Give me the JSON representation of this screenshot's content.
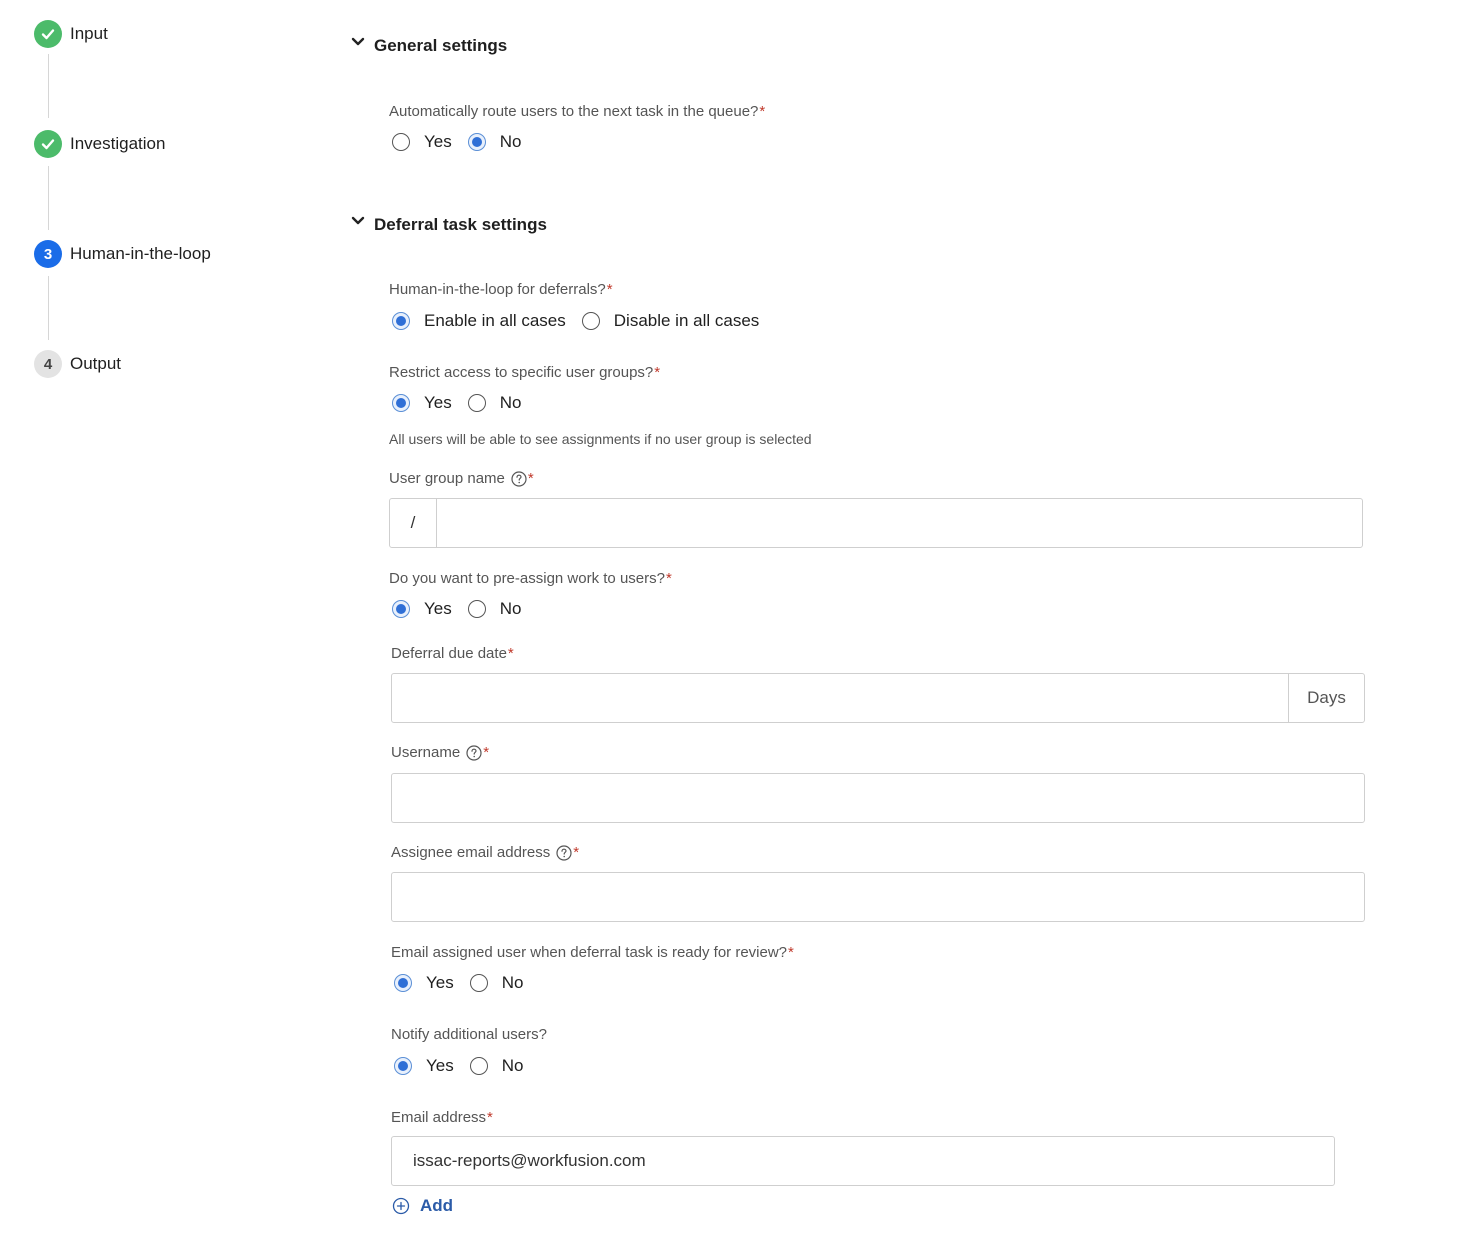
{
  "stepper": {
    "steps": [
      {
        "number": "",
        "label": "Input",
        "state": "done"
      },
      {
        "number": "",
        "label": "Investigation",
        "state": "done"
      },
      {
        "number": "3",
        "label": "Human-in-the-loop",
        "state": "active"
      },
      {
        "number": "4",
        "label": "Output",
        "state": "pending"
      }
    ]
  },
  "general": {
    "title": "General settings",
    "route_question": "Automatically route users to the next task in the queue?",
    "route_options": [
      "Yes",
      "No"
    ],
    "route_selected": "No"
  },
  "deferral": {
    "title": "Deferral task settings",
    "hitl_question": "Human-in-the-loop for deferrals?",
    "hitl_options": [
      "Enable in all cases",
      "Disable in all cases"
    ],
    "hitl_selected": "Enable in all cases",
    "restrict_question": "Restrict access to specific user groups?",
    "restrict_options": [
      "Yes",
      "No"
    ],
    "restrict_selected": "Yes",
    "restrict_hint": "All users will be able to see assignments if no user group is selected",
    "user_group_label": "User group name",
    "user_group_prefix": "/",
    "user_group_value": "",
    "preassign_question": "Do you want to pre-assign work to users?",
    "preassign_options": [
      "Yes",
      "No"
    ],
    "preassign_selected": "Yes",
    "due_date_label": "Deferral due date",
    "due_date_value": "",
    "due_date_suffix": "Days",
    "username_label": "Username",
    "username_value": "",
    "assignee_email_label": "Assignee email address",
    "assignee_email_value": "",
    "email_review_question": "Email assigned user when deferral task is ready for review?",
    "email_review_options": [
      "Yes",
      "No"
    ],
    "email_review_selected": "Yes",
    "notify_question": "Notify additional users?",
    "notify_options": [
      "Yes",
      "No"
    ],
    "notify_selected": "Yes",
    "email_address_label": "Email address",
    "email_address_value": "issac-reports@workfusion.com",
    "add_label": "Add"
  },
  "required_mark": "*",
  "colors": {
    "done": "#4cbb6a",
    "active": "#1a6ce8",
    "radio_checked": "#2f6fd6",
    "required": "#c0392b",
    "link": "#2b5ba8"
  }
}
